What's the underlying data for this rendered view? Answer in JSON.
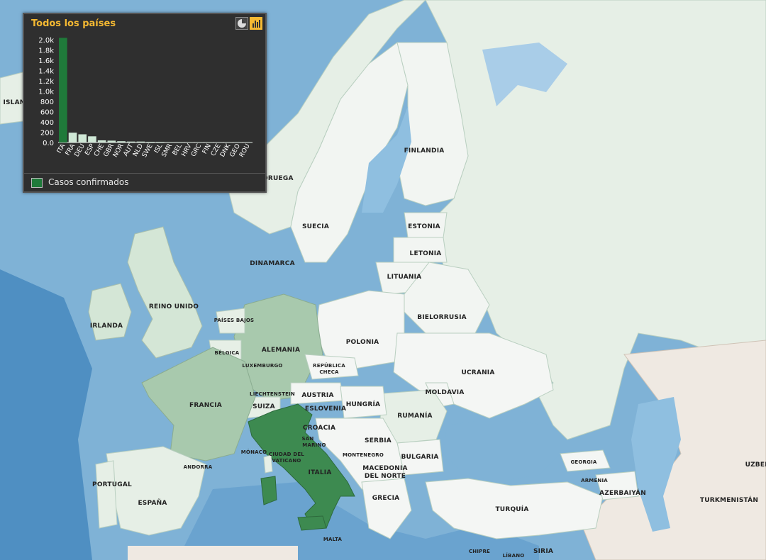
{
  "panel": {
    "title": "Todos los países",
    "buttons": {
      "pie_icon": "pie-chart-icon",
      "bar_icon": "bar-chart-icon"
    },
    "legend_label": "Casos confirmados",
    "legend_color": "#1f7a3a"
  },
  "chart_data": {
    "type": "bar",
    "categories": [
      "ITA",
      "FRA",
      "DEU",
      "ESP",
      "CHE",
      "GBR",
      "NOR",
      "AUT",
      "NLD",
      "SWE",
      "ISL",
      "SMR",
      "BEL",
      "HRV",
      "GRC",
      "FIN",
      "CZE",
      "DNK",
      "GEO",
      "ROU"
    ],
    "series": [
      {
        "name": "Casos confirmados",
        "values": [
          2036,
          191,
          159,
          120,
          42,
          36,
          25,
          18,
          18,
          14,
          12,
          8,
          8,
          7,
          7,
          6,
          5,
          4,
          3,
          3
        ]
      }
    ],
    "highlight_color": "#1f7a3a",
    "other_color": "#cfe8d6",
    "ylim": [
      0,
      2000
    ],
    "yticks": [
      "0.0",
      "200",
      "400",
      "600",
      "800",
      "1.0k",
      "1.2k",
      "1.4k",
      "1.6k",
      "1.8k",
      "2.0k"
    ],
    "ytick_values": [
      0,
      200,
      400,
      600,
      800,
      1000,
      1200,
      1400,
      1600,
      1800,
      2000
    ]
  },
  "map": {
    "colors": {
      "sea": "#7fb2d6",
      "deep_sea": "#4f8fc2",
      "land_default": "#e6efe6",
      "land_light": "#f4f6f4",
      "level_high": "#3d8a50",
      "level_mid": "#a8c9ad",
      "level_low": "#d4e6d6",
      "outside": "#efe9e2"
    },
    "labels": [
      "ISLAN",
      "NORUEGA",
      "FINLANDIA",
      "SUECIA",
      "ESTONIA",
      "LETONIA",
      "LITUANIA",
      "DINAMARCA",
      "REINO UNIDO",
      "IRLANDA",
      "PAÍSES BAJOS",
      "BÉLGICA",
      "LUXEMBURGO",
      "ALEMANIA",
      "POLONIA",
      "BIELORRUSIA",
      "UCRANIA",
      "REPÚBLICA",
      "CHECA",
      "LIECHTENSTEIN",
      "AUSTRIA",
      "MOLDAVIA",
      "FRANCIA",
      "SUIZA",
      "ESLOVENIA",
      "HUNGRÍA",
      "RUMANÍA",
      "CROACIA",
      "SAN",
      "MARINO",
      "SERBIA",
      "BULGARIA",
      "MÓNACO",
      "CIUDAD DEL",
      "VATICANO",
      "ANDORRA",
      "ITALIA",
      "MONTENEGRO",
      "MACEDONIA",
      "DEL NORTE",
      "GEORGIA",
      "ARMENIA",
      "AZERBAIYÁN",
      "PORTUGAL",
      "ESPAÑA",
      "GRECIA",
      "TURQUÍA",
      "TURKMENISTÁN",
      "UZBEK",
      "MALTA",
      "CHIPRE",
      "LÍBANO",
      "SIRIA"
    ]
  }
}
